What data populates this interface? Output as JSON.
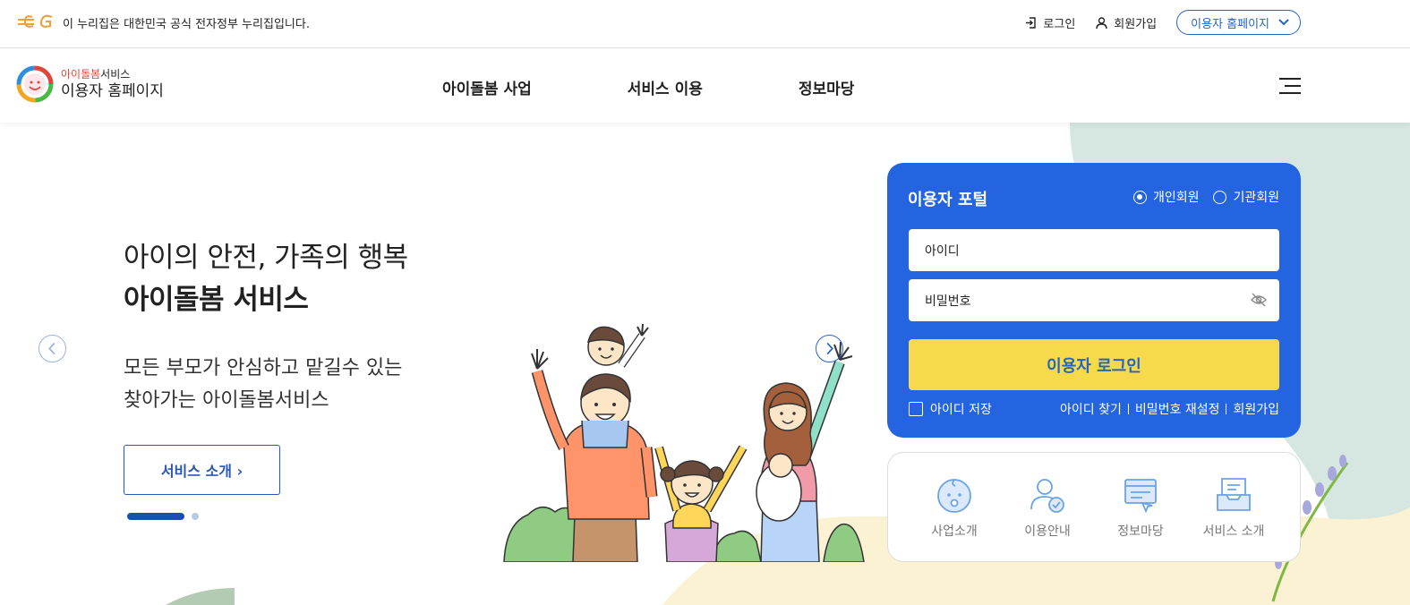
{
  "gov_bar": {
    "notice": "이 누리집은 대한민국 공식 전자정부 누리집입니다.",
    "login": "로그인",
    "signup": "회원가입",
    "homepage_select": "이용자 홈페이지"
  },
  "header": {
    "brand_red": "아이돌봄",
    "brand_rest": "서비스",
    "brand_title": "이용자 홈페이지",
    "nav": [
      "아이돌봄 사업",
      "서비스 이용",
      "정보마당"
    ]
  },
  "hero": {
    "line1": "아이의 안전, 가족의 행복",
    "line2": "아이돌봄 서비스",
    "sub1": "모든 부모가 안심하고 맡길수 있는",
    "sub2": "찾아가는 아이돌봄서비스",
    "button": "서비스 소개 ›"
  },
  "portal": {
    "title": "이용자 포털",
    "radio_personal": "개인회원",
    "radio_org": "기관회원",
    "id_placeholder": "아이디",
    "pw_placeholder": "비밀번호",
    "login_button": "이용자 로그인",
    "save_id": "아이디 저장",
    "find_id": "아이디 찾기",
    "reset_pw": "비밀번호 재설정",
    "signup": "회원가입"
  },
  "quick_links": [
    "사업소개",
    "이용안내",
    "정보마당",
    "서비스 소개"
  ],
  "colors": {
    "primary_blue": "#2464e0",
    "login_yellow": "#f7d94c",
    "brand_red": "#e2463b"
  }
}
